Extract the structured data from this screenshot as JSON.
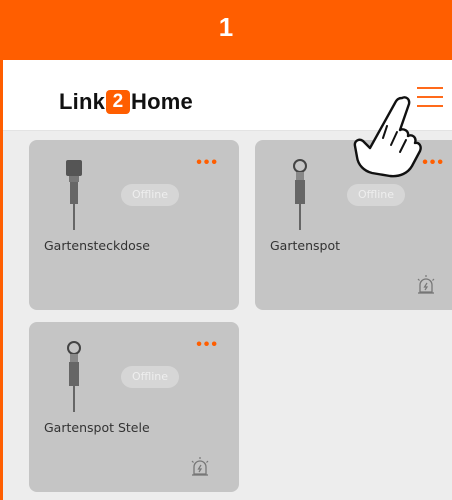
{
  "step": {
    "number": "1",
    "color": "#ff5e00"
  },
  "app": {
    "brand_prefix": "Link",
    "brand_number": "2",
    "brand_suffix": "Home",
    "menu_icon": "hamburger-menu-icon"
  },
  "cards": [
    {
      "name": "Gartensteckdose",
      "status": "Offline",
      "more": "•••",
      "device_icon": "garden-socket-icon",
      "alarm_icon": ""
    },
    {
      "name": "Gartenspot",
      "status": "Offline",
      "more": "•••",
      "device_icon": "garden-spotlight-icon",
      "alarm_icon": "alarm-light-icon"
    },
    {
      "name": "Gartenspot Stele",
      "status": "Offline",
      "more": "•••",
      "device_icon": "garden-spotlight-icon",
      "alarm_icon": "alarm-light-icon"
    }
  ],
  "overlay": {
    "pointer_icon": "hand-pointer-icon"
  }
}
